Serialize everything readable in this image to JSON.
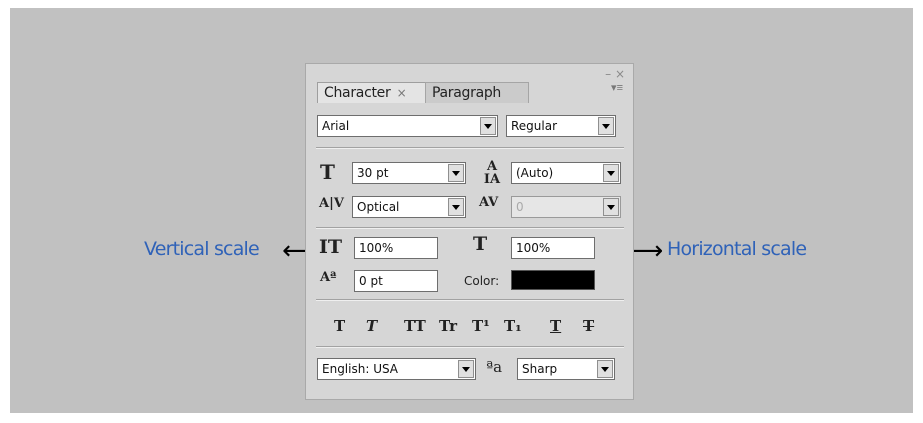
{
  "annotations": {
    "vertical_scale": "Vertical scale",
    "horizontal_scale": "Horizontal scale"
  },
  "panel": {
    "window_controls": "– ×",
    "tabs": [
      {
        "label": "Character",
        "close": "×",
        "active": true
      },
      {
        "label": "Paragraph",
        "active": false
      }
    ],
    "font_family": "Arial",
    "font_style": "Regular",
    "font_size": "30 pt",
    "leading": "(Auto)",
    "kerning": "Optical",
    "tracking": "0",
    "vertical_scale": "100%",
    "horizontal_scale": "100%",
    "baseline_shift": "0 pt",
    "color_label": "Color:",
    "color_value": "#000000",
    "style_buttons": [
      "T",
      "T",
      "TT",
      "Tr",
      "T¹",
      "T₁",
      "T",
      "T"
    ],
    "language": "English: USA",
    "antialias_icon": "ªa",
    "antialias": "Sharp"
  }
}
